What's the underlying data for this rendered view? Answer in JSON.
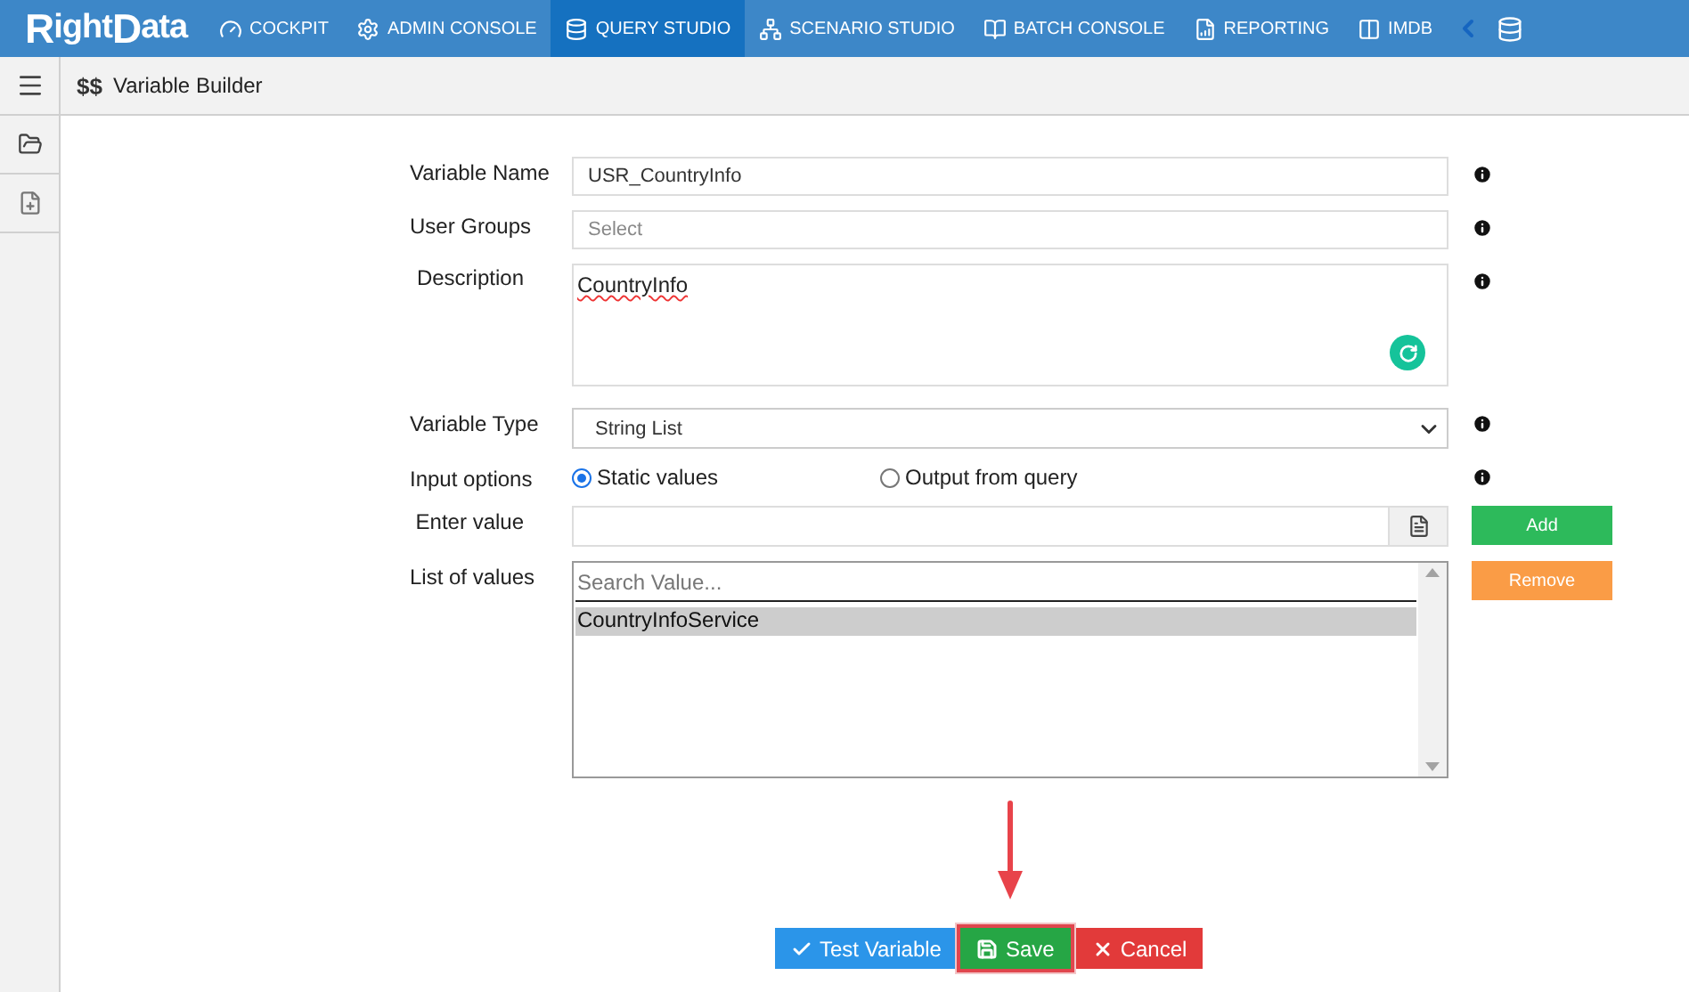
{
  "app": {
    "logo_first": "R",
    "logo_rest": "ight",
    "logo_second": "D",
    "logo_end": "ata"
  },
  "nav": [
    {
      "label": "COCKPIT",
      "kind": "gauge",
      "selected": false
    },
    {
      "label": "ADMIN CONSOLE",
      "kind": "gear",
      "selected": false
    },
    {
      "label": "QUERY STUDIO",
      "kind": "database",
      "selected": true
    },
    {
      "label": "SCENARIO STUDIO",
      "kind": "network",
      "selected": false
    },
    {
      "label": "BATCH CONSOLE",
      "kind": "book",
      "selected": false
    },
    {
      "label": "REPORTING",
      "kind": "report",
      "selected": false
    },
    {
      "label": "IMDB",
      "kind": "columns",
      "selected": false
    }
  ],
  "header": {
    "badge": "$$",
    "title": "Variable Builder"
  },
  "form": {
    "fields": [
      {
        "label": "Variable Name",
        "kind": "text",
        "value": "USR_CountryInfo"
      },
      {
        "label": "User Groups",
        "kind": "text",
        "placeholder": "Select"
      },
      {
        "label": "Description",
        "kind": "textarea",
        "value": "CountryInfo"
      },
      {
        "label": "Variable Type",
        "kind": "select",
        "value": "String List"
      },
      {
        "label": "Input options",
        "kind": "radio",
        "options": [
          {
            "label": "Static values",
            "selected": true
          },
          {
            "label": "Output from query",
            "selected": false
          }
        ]
      },
      {
        "label": "Enter value",
        "kind": "file",
        "action": {
          "label": "Add",
          "kind": "add"
        }
      },
      {
        "label": "List of values",
        "kind": "list",
        "placeholder": "Search Value...",
        "items": [
          {
            "label": "CountryInfoService",
            "selected": true
          }
        ],
        "action": {
          "label": "Remove",
          "kind": "remove"
        }
      }
    ]
  },
  "footer": {
    "buttons": [
      {
        "label": "Test Variable",
        "kind": "test",
        "highlighted": false
      },
      {
        "label": "Save",
        "kind": "save",
        "highlighted": true
      },
      {
        "label": "Cancel",
        "kind": "cancel",
        "highlighted": false
      }
    ]
  }
}
